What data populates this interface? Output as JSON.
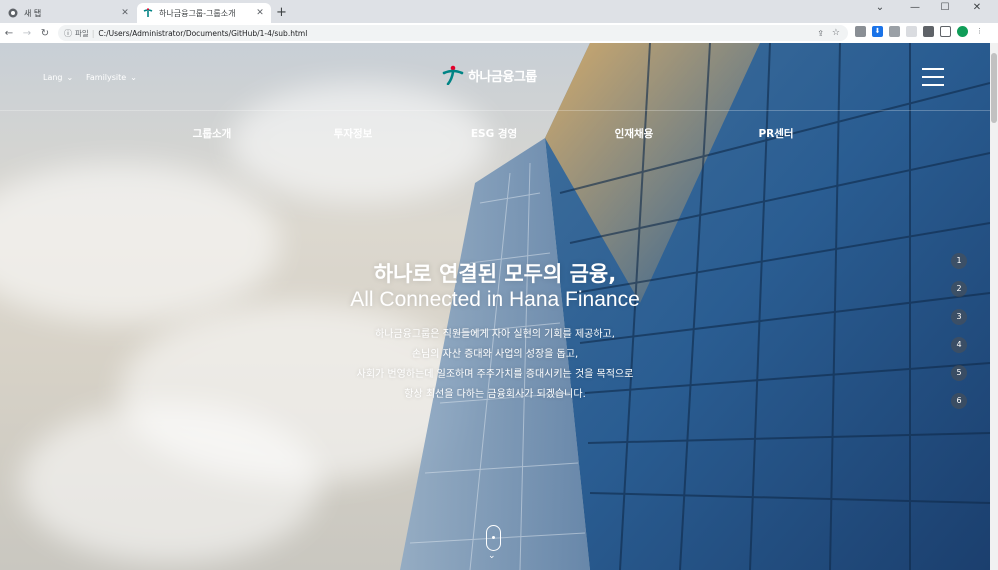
{
  "browser": {
    "tabs": [
      {
        "title": "새 탭",
        "active": false
      },
      {
        "title": "하나금융그룹-그룹소개",
        "active": true
      }
    ],
    "new_tab_glyph": "+",
    "address": {
      "scheme_label": "파일",
      "url": "C:/Users/Administrator/Documents/GitHub/1-4/sub.html"
    },
    "window_controls": [
      "⌄",
      "—",
      "☐",
      "✕"
    ]
  },
  "site": {
    "utility": [
      {
        "label": "Lang"
      },
      {
        "label": "Familysite"
      }
    ],
    "logo_text": "하나금융그룹",
    "menu": [
      "그룹소개",
      "투자정보",
      "ESG 경영",
      "인재채용",
      "PR센터"
    ],
    "hero": {
      "title_ko": "하나로 연결된 모두의 금융,",
      "title_en": "All Connected in Hana Finance",
      "description": [
        "하나금융그룹은 직원들에게 자아 실현의 기회를 제공하고,",
        "손님의 자산 증대와 사업의 성장을 돕고,",
        "사회가 번영하는데 일조하며 주주가치를 증대시키는 것을 목적으로",
        "항상 최선을 다하는 금융회사가 되겠습니다."
      ]
    },
    "pager": [
      "1",
      "2",
      "3",
      "4",
      "5",
      "6"
    ]
  },
  "colors": {
    "brand_green": "#008485",
    "brand_red": "#e4002b",
    "sky": "#c8cfd6",
    "glass_blue": "#1f4f86"
  },
  "icons": {
    "tab_favicon_inactive": "chrome-icon",
    "tab_favicon_active": "hana-logo-icon",
    "scroll_hint": "mouse-scroll-icon"
  }
}
